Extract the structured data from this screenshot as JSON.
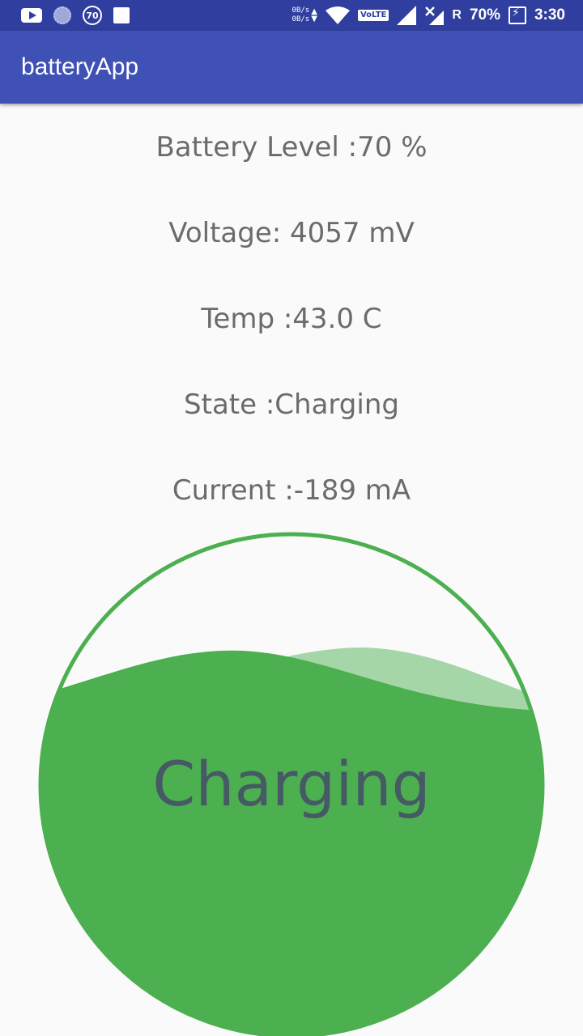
{
  "status_bar": {
    "badge_number": "70",
    "net_up": "0B/s",
    "net_down": "0B/s",
    "volte": "VoLTE",
    "roaming": "R",
    "battery_percent": "70%",
    "time": "3:30"
  },
  "app_bar": {
    "title": "batteryApp"
  },
  "info": {
    "battery_level_label": "Battery Level :",
    "battery_level_value": "70 %",
    "voltage_label": "Voltage: ",
    "voltage_value": "4057 mV",
    "temp_label": "Temp :",
    "temp_value": "43.0 C",
    "state_label": "State :",
    "state_value": "Charging",
    "current_label": "Current :",
    "current_value": "-189 mA"
  },
  "wave": {
    "level_fraction": 0.7,
    "label": "Charging",
    "fill_color": "#4caf50",
    "back_wave_color": "#a5d6a7",
    "outline_color": "#4caf50"
  }
}
